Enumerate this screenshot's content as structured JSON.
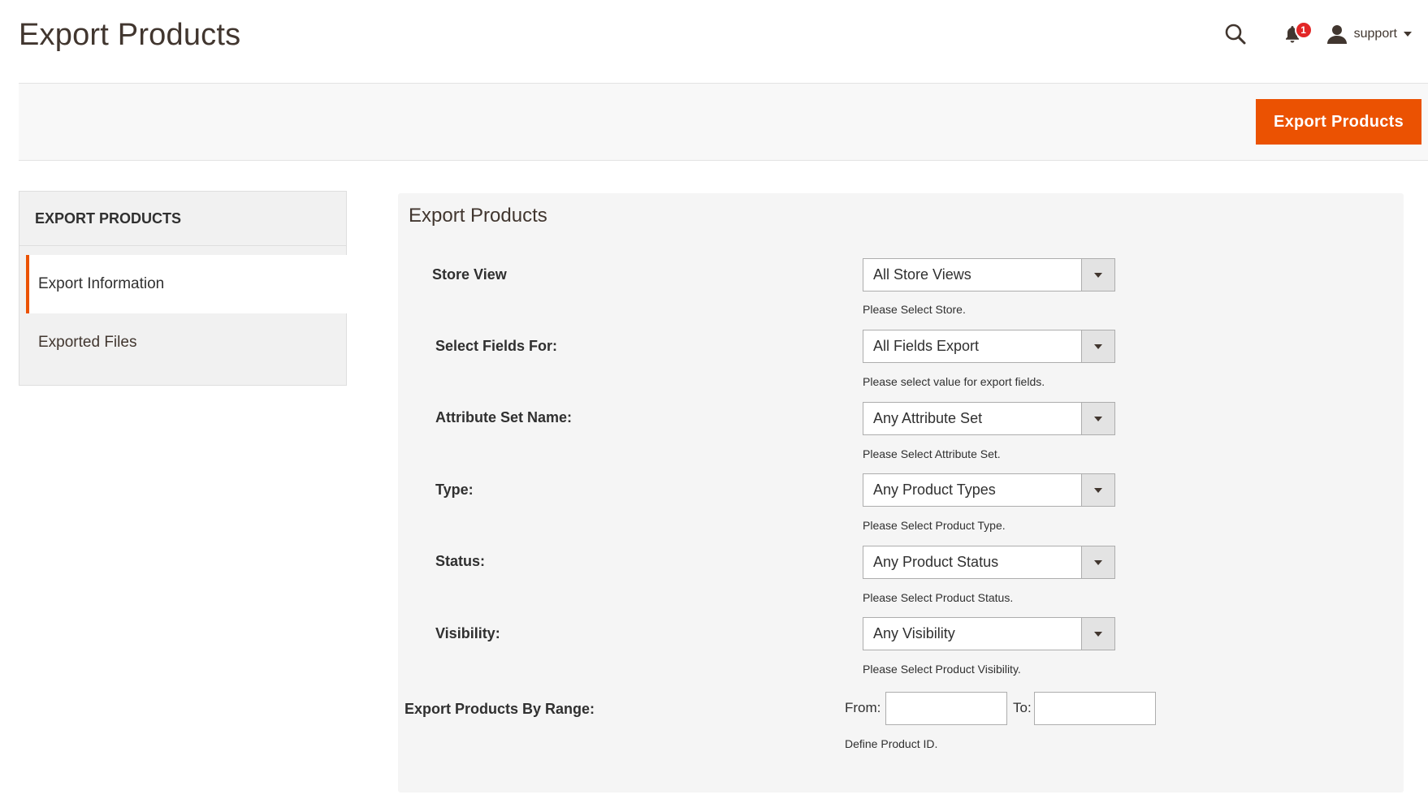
{
  "header": {
    "title": "Export Products",
    "search_icon": "search-icon",
    "notifications": {
      "icon": "bell-icon",
      "count": "1"
    },
    "user": {
      "icon": "user-icon",
      "name": "support"
    }
  },
  "action_bar": {
    "export_button_label": "Export Products"
  },
  "sidebar": {
    "title": "EXPORT PRODUCTS",
    "items": [
      {
        "label": "Export Information",
        "active": true
      },
      {
        "label": "Exported Files",
        "active": false
      }
    ]
  },
  "form": {
    "title": "Export Products",
    "fields": [
      {
        "label": "Store View",
        "value": "All Store Views",
        "note": "Please Select Store."
      },
      {
        "label": "Select Fields For:",
        "value": "All Fields Export",
        "note": "Please select value for export fields."
      },
      {
        "label": "Attribute Set Name:",
        "value": "Any Attribute Set",
        "note": "Please Select Attribute Set."
      },
      {
        "label": "Type:",
        "value": "Any Product Types",
        "note": "Please Select Product Type."
      },
      {
        "label": "Status:",
        "value": "Any Product Status",
        "note": "Please Select Product Status."
      },
      {
        "label": "Visibility:",
        "value": "Any Visibility",
        "note": "Please Select Product Visibility."
      }
    ],
    "range": {
      "label": "Export Products By Range:",
      "from_label": "From:",
      "from_value": "",
      "to_label": "To:",
      "to_value": "",
      "note": "Define Product ID."
    }
  },
  "colors": {
    "accent": "#eb5202",
    "badge": "#e22626",
    "panel_bg": "#f5f5f5"
  }
}
